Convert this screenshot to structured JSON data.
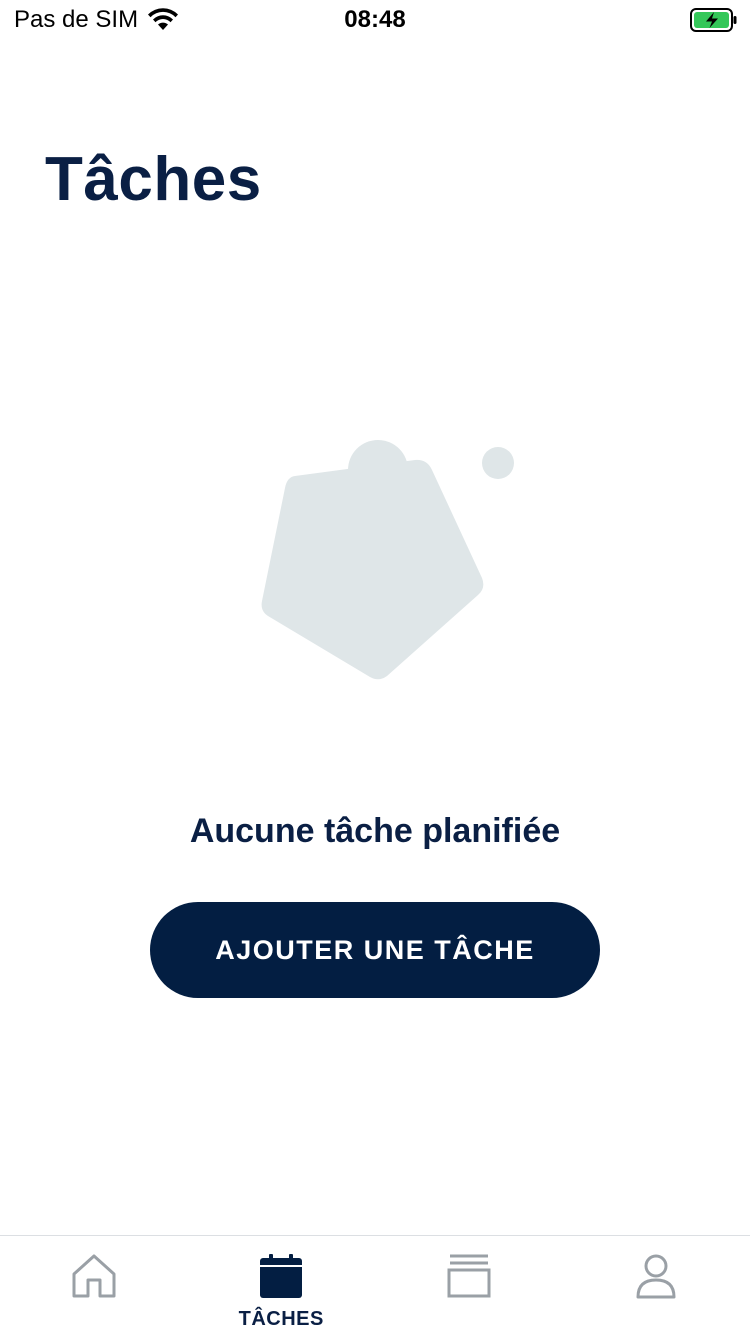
{
  "status_bar": {
    "carrier": "Pas de SIM",
    "time": "08:48",
    "wifi_icon": "wifi-icon",
    "battery_icon": "battery-charging-icon",
    "battery_color": "#34c759"
  },
  "header": {
    "title": "Tâches"
  },
  "empty_state": {
    "illustration_icon": "empty-tasks-illustration",
    "message": "Aucune tâche planifiée",
    "button_label": "AJOUTER UNE TÂCHE"
  },
  "tab_bar": {
    "tabs": [
      {
        "id": "home",
        "icon": "home-icon",
        "label": "",
        "active": false
      },
      {
        "id": "tasks",
        "icon": "calendar-icon",
        "label": "TÂCHES",
        "active": true
      },
      {
        "id": "documents",
        "icon": "stack-icon",
        "label": "",
        "active": false
      },
      {
        "id": "profile",
        "icon": "user-icon",
        "label": "",
        "active": false
      }
    ]
  },
  "colors": {
    "primary": "#031e42",
    "title_text": "#0a1f44",
    "illustration": "#dfe6e8",
    "inactive_icon": "#9aa0a6",
    "background": "#ffffff"
  }
}
